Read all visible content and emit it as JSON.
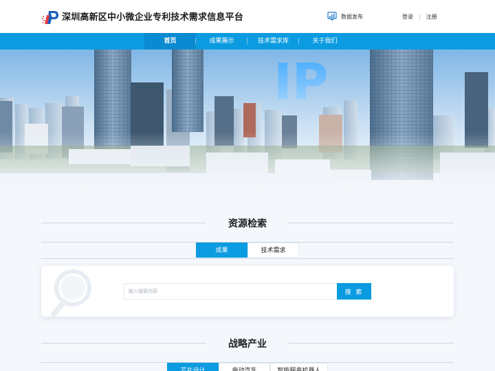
{
  "header": {
    "site_title": "深圳高新区中小微企业专利技术需求信息平台",
    "publish_label": "数据发布",
    "login_label": "登录",
    "separator": "|",
    "register_label": "注册"
  },
  "nav": {
    "items": [
      {
        "label": "首页",
        "active": true
      },
      {
        "label": "成果展示",
        "active": false
      },
      {
        "label": "技术需求库",
        "active": false
      },
      {
        "label": "关于我们",
        "active": false
      }
    ]
  },
  "banner": {
    "sign_text": "IP"
  },
  "resource_search": {
    "title": "资源检索",
    "tabs": [
      {
        "label": "成果",
        "active": true
      },
      {
        "label": "技术需求",
        "active": false
      }
    ],
    "input_placeholder": "输入搜索内容",
    "input_value": "",
    "button_label": "搜 索"
  },
  "strategic_industry": {
    "title": "战略产业",
    "tabs": [
      {
        "label": "芯片设计",
        "active": true
      },
      {
        "label": "电动汽车",
        "active": false
      },
      {
        "label": "智能服务机器人",
        "active": false
      }
    ]
  },
  "colors": {
    "primary": "#0b9be0",
    "primary_dark": "#0a8ad1",
    "page_bg": "#f4f7fb"
  }
}
